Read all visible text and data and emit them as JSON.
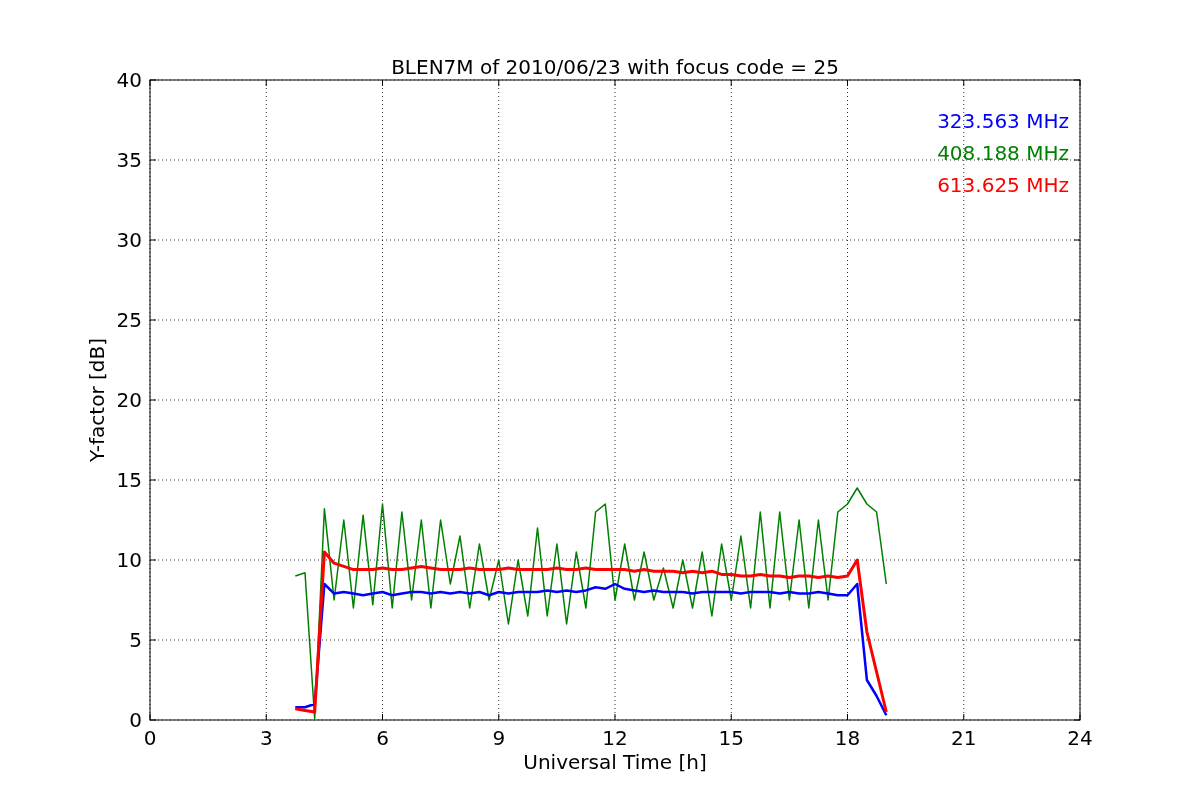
{
  "chart_data": {
    "type": "line",
    "title": "BLEN7M of 2010/06/23 with focus code = 25",
    "xlabel": "Universal Time [h]",
    "ylabel": "Y-factor [dB]",
    "x": [
      3.75,
      4,
      4.25,
      4.5,
      4.75,
      5,
      5.25,
      5.5,
      5.75,
      6,
      6.25,
      6.5,
      6.75,
      7,
      7.25,
      7.5,
      7.75,
      8,
      8.25,
      8.5,
      8.75,
      9,
      9.25,
      9.5,
      9.75,
      10,
      10.25,
      10.5,
      10.75,
      11,
      11.25,
      11.5,
      11.75,
      12,
      12.25,
      12.5,
      12.75,
      13,
      13.25,
      13.5,
      13.75,
      14,
      14.25,
      14.5,
      14.75,
      15,
      15.25,
      15.5,
      15.75,
      16,
      16.25,
      16.5,
      16.75,
      17,
      17.25,
      17.5,
      17.75,
      18,
      18.25,
      18.5,
      18.75,
      19
    ],
    "series": [
      {
        "name": "323.563 MHz",
        "color": "#0000ff",
        "values": [
          0.8,
          0.8,
          1.0,
          8.5,
          7.9,
          8.0,
          7.9,
          7.8,
          7.9,
          8.0,
          7.8,
          7.9,
          8.0,
          8.0,
          7.9,
          8.0,
          7.9,
          8.0,
          7.9,
          8.0,
          7.8,
          8.0,
          7.9,
          8.0,
          8.0,
          8.0,
          8.1,
          8.0,
          8.1,
          8.0,
          8.1,
          8.3,
          8.2,
          8.5,
          8.2,
          8.1,
          8.0,
          8.1,
          8.0,
          8.0,
          8.0,
          7.9,
          8.0,
          8.0,
          8.0,
          8.0,
          7.9,
          8.0,
          8.0,
          8.0,
          7.9,
          8.0,
          7.9,
          7.9,
          8.0,
          7.9,
          7.8,
          7.8,
          8.5,
          2.5,
          1.5,
          0.3
        ]
      },
      {
        "name": "408.188 MHz",
        "color": "#008000",
        "values": [
          9.0,
          9.2,
          0.1,
          13.2,
          7.5,
          12.5,
          7.0,
          12.8,
          7.2,
          13.5,
          7.0,
          13.0,
          7.5,
          12.5,
          7.0,
          12.5,
          8.5,
          11.5,
          7.0,
          11.0,
          7.5,
          10.0,
          6.0,
          10.0,
          6.5,
          12.0,
          6.5,
          11.0,
          6.0,
          10.5,
          7.0,
          13.0,
          13.5,
          7.5,
          11.0,
          7.5,
          10.5,
          7.5,
          9.5,
          7.0,
          10.0,
          7.0,
          10.5,
          6.5,
          11.0,
          7.5,
          11.5,
          7.0,
          13.0,
          7.0,
          13.0,
          7.5,
          12.5,
          7.0,
          12.5,
          7.5,
          13.0,
          13.5,
          14.5,
          13.5,
          13.0,
          8.5
        ]
      },
      {
        "name": "613.625 MHz",
        "color": "#ff0000",
        "values": [
          0.7,
          0.6,
          0.5,
          10.5,
          9.8,
          9.6,
          9.4,
          9.4,
          9.4,
          9.5,
          9.4,
          9.4,
          9.5,
          9.6,
          9.5,
          9.4,
          9.4,
          9.4,
          9.5,
          9.4,
          9.4,
          9.4,
          9.5,
          9.4,
          9.4,
          9.4,
          9.4,
          9.5,
          9.4,
          9.4,
          9.5,
          9.4,
          9.4,
          9.4,
          9.4,
          9.3,
          9.4,
          9.3,
          9.3,
          9.3,
          9.2,
          9.3,
          9.2,
          9.3,
          9.1,
          9.1,
          9.0,
          9.0,
          9.1,
          9.0,
          9.0,
          8.9,
          9.0,
          9.0,
          8.9,
          9.0,
          8.9,
          9.0,
          10.0,
          5.5,
          3.0,
          0.5
        ]
      }
    ],
    "xlim": [
      0,
      24
    ],
    "ylim": [
      0,
      40
    ],
    "xticks": [
      0,
      3,
      6,
      9,
      12,
      15,
      18,
      21,
      24
    ],
    "yticks": [
      0,
      5,
      10,
      15,
      20,
      25,
      30,
      35,
      40
    ],
    "grid": true
  }
}
